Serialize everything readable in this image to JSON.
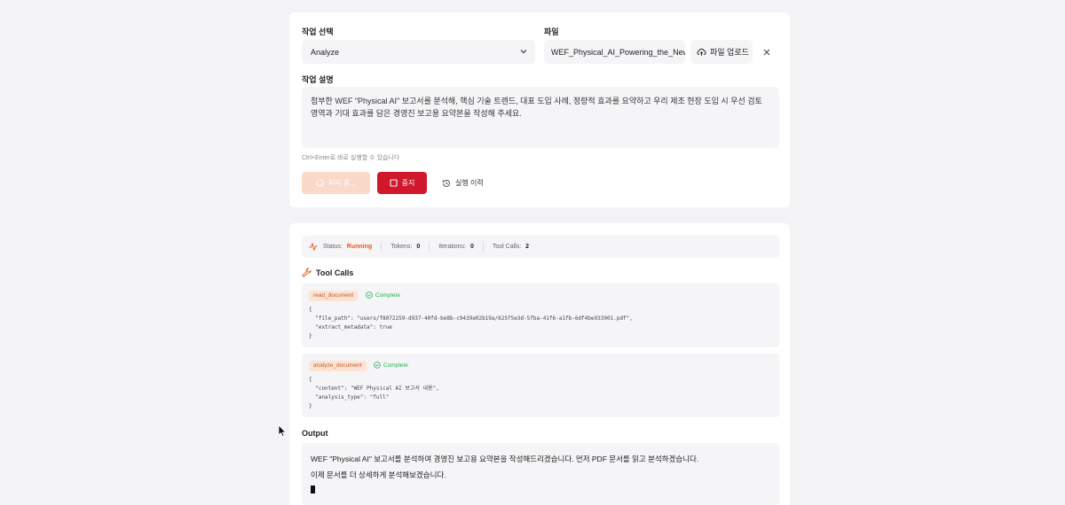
{
  "form": {
    "task_label": "작업 선택",
    "task_value": "Analyze",
    "file_label": "파일",
    "file_value": "WEF_Physical_AI_Powering_the_New_Ag",
    "upload_label": "파일 업로드",
    "desc_label": "작업 설명",
    "desc_text": "첨부한 WEF \"Physical AI\" 보고서를 분석해, 핵심 기술 트렌드, 대표 도입 사례, 정량적 효과를 요약하고 우리 제조 현장 도입 시 우선 검토 영역과 기대 효과를 담은 경영진 보고용 요약본을 작성해 주세요.",
    "hint": "Ctrl+Enter로 바로 실행할 수 있습니다",
    "running_label": "처리 중...",
    "stop_label": "중지",
    "history_label": "실행 이력"
  },
  "status": {
    "status_label": "Status:",
    "status_value": "Running",
    "tokens_label": "Tokens:",
    "tokens_value": "0",
    "iterations_label": "Iterations:",
    "iterations_value": "0",
    "toolcalls_label": "Tool Calls:",
    "toolcalls_value": "2"
  },
  "tool_calls": {
    "title": "Tool Calls",
    "items": [
      {
        "name": "read_document",
        "state": "Complete",
        "code": "{\n  \"file_path\": \"users/f8072259-d937-40fd-be8b-c9439a02b19a/625f5e3d-5fba-41f6-a1fb-6df4be933901.pdf\",\n  \"extract_metadata\": true\n}"
      },
      {
        "name": "analyze_document",
        "state": "Complete",
        "code": "{\n  \"content\": \"WEF Physical AI 보고서 내용\",\n  \"analysis_type\": \"full\"\n}"
      }
    ]
  },
  "output": {
    "title": "Output",
    "line1": "WEF \"Physical AI\" 보고서를 분석하여 경영진 보고용 요약본을 작성해드리겠습니다. 먼저 PDF 문서를 읽고 분석하겠습니다.",
    "line2": "이제 문서를 더 상세하게 분석해보겠습니다."
  },
  "colors": {
    "accent": "#d0172c",
    "running": "#e8591f",
    "complete": "#22b14c",
    "tag_bg": "#fde3d3"
  }
}
